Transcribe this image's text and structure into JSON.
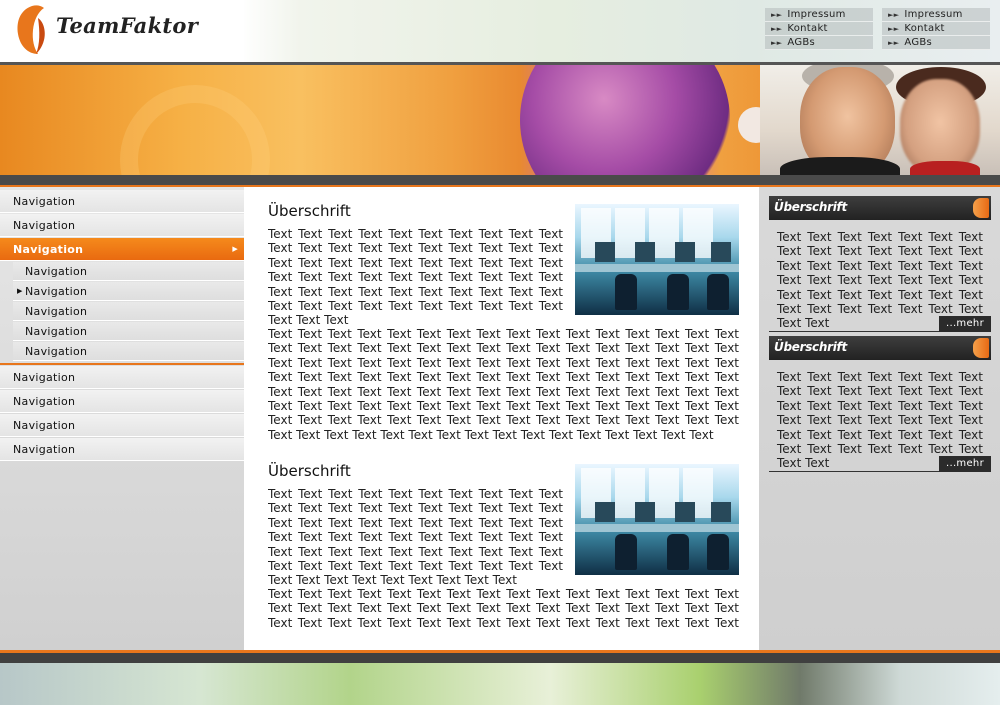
{
  "brand": {
    "name": "TeamFaktor",
    "accent": "#e8761c"
  },
  "meta_links": {
    "left": [
      {
        "label": "Impressum"
      },
      {
        "label": "Kontakt"
      },
      {
        "label": "AGBs"
      }
    ],
    "right": [
      {
        "label": "Impressum"
      },
      {
        "label": "Kontakt"
      },
      {
        "label": "AGBs"
      }
    ]
  },
  "nav": {
    "top_items": [
      {
        "label": "Navigation"
      },
      {
        "label": "Navigation"
      },
      {
        "label": "Navigation",
        "active": true
      }
    ],
    "sub_items": [
      {
        "label": "Navigation"
      },
      {
        "label": "Navigation",
        "marker": "bullet"
      },
      {
        "label": "Navigation"
      },
      {
        "label": "Navigation",
        "marker": "chevron"
      },
      {
        "label": "Navigation"
      }
    ],
    "bottom_items": [
      {
        "label": "Navigation"
      },
      {
        "label": "Navigation"
      },
      {
        "label": "Navigation"
      },
      {
        "label": "Navigation"
      }
    ]
  },
  "content": {
    "articles": [
      {
        "title": "Überschrift",
        "text_beside": "Text Text Text Text Text Text Text Text Text Text Text Text Text Text Text Text Text Text Text Text Text Text Text Text Text Text Text Text Text Text Text Text Text Text Text Text Text Text Text Text Text Text Text Text Text Text Text Text Text Text Text Text Text Text Text Text Text Text Text Text Text Text Text",
        "text_below": "Text Text Text Text Text Text Text Text Text Text Text Text Text Text Text Text Text Text Text Text Text Text Text Text Text Text Text Text Text Text Text Text Text Text Text Text Text Text Text Text Text Text Text Text Text Text Text Text Text Text Text Text Text Text Text Text Text Text Text Text Text Text Text Text Text Text Text Text Text Text Text Text Text Text Text Text Text Text Text Text Text Text Text Text Text Text Text Text Text Text Text Text Text Text Text Text Text Text Text Text Text Text Text Text Text Text Text Text Text Text Text Text Text Text Text Text Text Text Text Text Text Text Text Text Text Text Text Text"
      },
      {
        "title": "Überschrift",
        "text_beside": "Text Text Text Text Text Text Text Text Text Text Text Text Text Text Text Text Text Text Text Text Text Text Text Text Text Text Text Text Text Text Text Text Text Text Text Text Text Text Text Text Text Text Text Text Text Text Text Text Text Text Text Text Text Text Text Text Text Text Text Text Text Text Text Text Text Text Text Text Text",
        "text_below": "Text Text Text Text Text Text Text Text Text Text Text Text Text Text Text Text Text Text Text Text Text Text Text Text Text Text Text Text Text Text Text Text Text Text Text Text Text Text Text Text Text Text Text Text Text Text Text Text Text Text Text Text Text Text Text Text Text"
      }
    ]
  },
  "sidebar_boxes": [
    {
      "title": "Überschrift",
      "text": "Text Text Text Text Text Text Text Text Text Text Text Text Text Text Text Text Text Text Text Text Text Text Text Text Text Text Text Text Text Text Text Text Text Text Text Text Text Text Text Text Text Text Text Text",
      "more": "...mehr"
    },
    {
      "title": "Überschrift",
      "text": "Text Text Text Text Text Text Text Text Text Text Text Text Text Text Text Text Text Text Text Text Text Text Text Text Text Text Text Text Text Text Text Text Text Text Text Text Text Text Text Text Text Text Text Text",
      "more": "...mehr"
    }
  ]
}
